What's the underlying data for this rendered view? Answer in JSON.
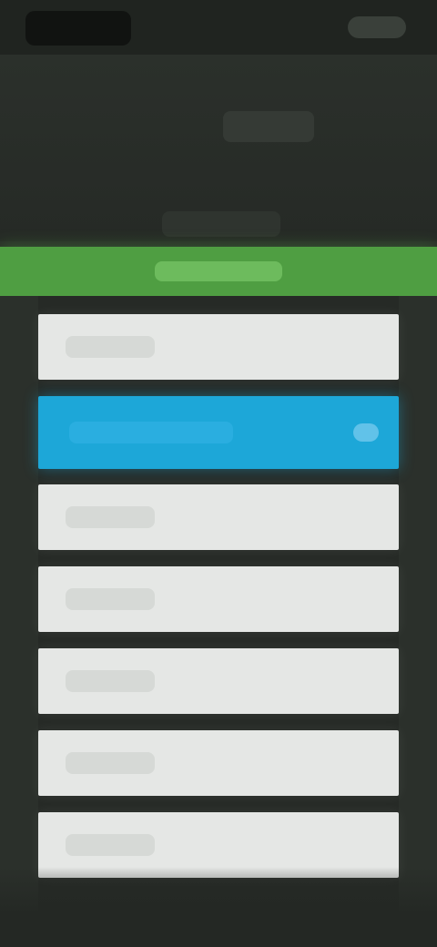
{
  "header": {
    "title": "",
    "subtitle": ""
  },
  "section": {
    "label": ""
  },
  "list": {
    "items": [
      {
        "label": ""
      },
      {
        "label": "",
        "selected": true
      },
      {
        "label": ""
      },
      {
        "label": ""
      },
      {
        "label": ""
      },
      {
        "label": ""
      },
      {
        "label": ""
      }
    ]
  },
  "colors": {
    "background": "#262a26",
    "section_bar": "#4f9e42",
    "selected_row": "#1da7d8",
    "row": "#e5e7e5"
  }
}
